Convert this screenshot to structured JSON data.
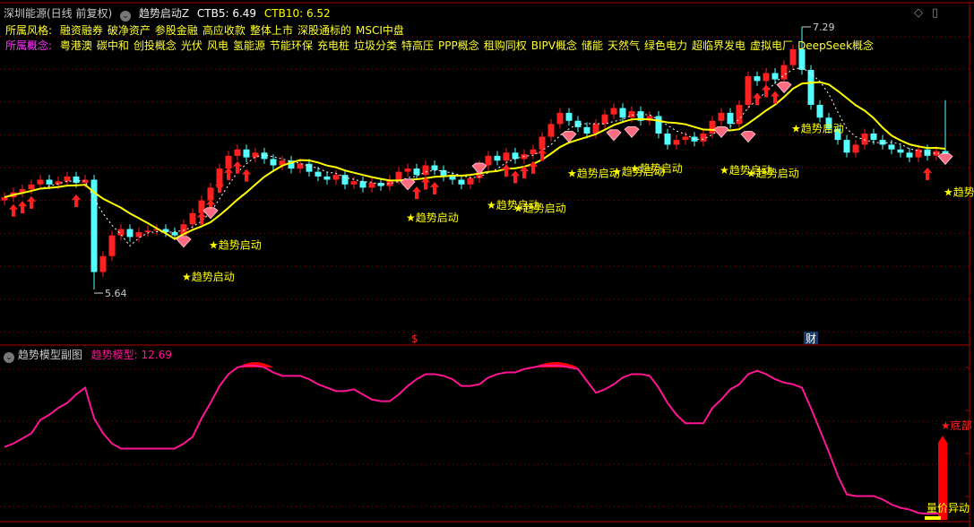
{
  "header": {
    "stock": "深圳能源(日线 前复权)",
    "indicator": "趋势启动Z",
    "ctb5_label": "CTB5: 6.49",
    "ctb10_label": "CTB10: 6.52"
  },
  "style_row": {
    "label": "所属风格:",
    "tags": [
      "融资融券",
      "破净资产",
      "参股金融",
      "高应收款",
      "整体上市",
      "深股通标的",
      "MSCI中盘"
    ]
  },
  "concept_row": {
    "label": "所属概念:",
    "tags": [
      "粤港澳",
      "碳中和",
      "创投概念",
      "光伏",
      "风电",
      "氢能源",
      "节能环保",
      "充电桩",
      "垃圾分类",
      "特高压",
      "PPP概念",
      "租购同权",
      "BIPV概念",
      "储能",
      "天然气",
      "绿色电力",
      "超临界发电",
      "虚拟电厂",
      "DeepSeek概念"
    ]
  },
  "sub_header": {
    "title": "趋势模型副图",
    "value_label": "趋势模型: 12.69"
  },
  "markers": {
    "s_mark": "$",
    "cai_mark": "财",
    "bottom_label": "★底部",
    "volume_label": "量价异动",
    "trend_label": "★趋势启动"
  },
  "colors": {
    "up": "#ff2020",
    "down": "#54ffff",
    "ma10": "#ffff00",
    "ma5": "#ffffff",
    "trend": "#ff1493",
    "grid": "#a00000"
  },
  "chart_data": [
    {
      "type": "candlestick",
      "title": "深圳能源 日线 前复权",
      "ylim": [
        5.55,
        7.35
      ],
      "closes": [
        6.22,
        6.25,
        6.27,
        6.3,
        6.33,
        6.3,
        6.32,
        6.35,
        6.31,
        6.33,
        5.75,
        5.85,
        5.98,
        6.02,
        5.97,
        6.0,
        6.01,
        6.02,
        6.0,
        5.98,
        6.05,
        6.12,
        6.2,
        6.28,
        6.4,
        6.48,
        6.52,
        6.47,
        6.5,
        6.46,
        6.42,
        6.45,
        6.4,
        6.43,
        6.38,
        6.35,
        6.33,
        6.36,
        6.3,
        6.32,
        6.28,
        6.31,
        6.29,
        6.33,
        6.38,
        6.4,
        6.36,
        6.42,
        6.39,
        6.35,
        6.33,
        6.3,
        6.34,
        6.42,
        6.48,
        6.45,
        6.5,
        6.46,
        6.49,
        6.52,
        6.6,
        6.68,
        6.75,
        6.7,
        6.66,
        6.62,
        6.68,
        6.74,
        6.78,
        6.72,
        6.76,
        6.7,
        6.73,
        6.62,
        6.55,
        6.58,
        6.6,
        6.57,
        6.62,
        6.7,
        6.75,
        6.68,
        6.8,
        6.98,
        6.95,
        7.0,
        6.96,
        7.05,
        7.15,
        7.02,
        6.8,
        6.72,
        6.65,
        6.58,
        6.5,
        6.55,
        6.62,
        6.58,
        6.55,
        6.52,
        6.5,
        6.47,
        6.52,
        6.48,
        6.51,
        6.49
      ],
      "extremes": [
        {
          "index": 10,
          "low": 5.64,
          "label": "5.64"
        },
        {
          "index": 89,
          "high": 7.29,
          "label": "7.29"
        },
        {
          "index": 105,
          "high": 6.83
        }
      ],
      "ma5_value": 6.49,
      "ma10_value": 6.52,
      "gem_signals": [
        {
          "index": 20,
          "price": 5.94
        },
        {
          "index": 23,
          "price": 6.12
        },
        {
          "index": 45,
          "price": 6.3
        },
        {
          "index": 53,
          "price": 6.4
        },
        {
          "index": 63,
          "price": 6.6
        },
        {
          "index": 68,
          "price": 6.61
        },
        {
          "index": 70,
          "price": 6.63
        },
        {
          "index": 80,
          "price": 6.63
        },
        {
          "index": 83,
          "price": 6.6
        },
        {
          "index": 87,
          "price": 6.91
        },
        {
          "index": 105,
          "price": 6.46
        }
      ],
      "arrow_signals": [
        1,
        2,
        3,
        8,
        22,
        23,
        24,
        25,
        26,
        27,
        46,
        47,
        48,
        56,
        57,
        58,
        59,
        60,
        84,
        85,
        86,
        103
      ],
      "trend_start_labels": [
        {
          "index": 20,
          "price": 5.72
        },
        {
          "index": 23,
          "price": 5.92
        },
        {
          "index": 45,
          "price": 6.09
        },
        {
          "index": 54,
          "price": 6.17
        },
        {
          "index": 57,
          "price": 6.15
        },
        {
          "index": 63,
          "price": 6.37
        },
        {
          "index": 68,
          "price": 6.38
        },
        {
          "index": 70,
          "price": 6.4
        },
        {
          "index": 80,
          "price": 6.39
        },
        {
          "index": 83,
          "price": 6.37
        },
        {
          "index": 88,
          "price": 6.65
        },
        {
          "index": 105,
          "price": 6.25
        }
      ],
      "event_marks": [
        {
          "index": 46,
          "text": "$"
        },
        {
          "index": 90,
          "text": "财"
        }
      ]
    },
    {
      "type": "line",
      "title": "趋势模型",
      "ylim": [
        10,
        100
      ],
      "current": 12.69,
      "values": [
        52,
        54,
        57,
        60,
        68,
        71,
        75,
        78,
        83,
        87,
        69,
        60,
        54,
        51,
        51,
        51,
        51,
        51,
        51,
        51,
        54,
        58,
        69,
        78,
        88,
        95,
        99,
        100,
        100,
        99,
        96,
        94,
        94,
        94,
        92,
        89,
        87,
        85,
        85,
        86,
        83,
        80,
        79,
        79,
        83,
        88,
        92,
        95,
        95,
        94,
        92,
        88,
        88,
        89,
        93,
        95,
        96,
        96,
        98,
        99,
        100,
        100,
        100,
        99,
        98,
        91,
        84,
        86,
        89,
        93,
        95,
        95,
        94,
        87,
        78,
        71,
        66,
        66,
        66,
        75,
        80,
        86,
        89,
        95,
        97,
        95,
        92,
        90,
        89,
        87,
        75,
        62,
        49,
        35,
        24,
        23,
        23,
        23,
        21,
        18,
        16,
        15,
        13,
        12.5,
        12.6,
        12.69
      ],
      "top_zones": [
        [
          26,
          30
        ],
        [
          59,
          64
        ]
      ],
      "bottom_signal_index": 105
    }
  ]
}
